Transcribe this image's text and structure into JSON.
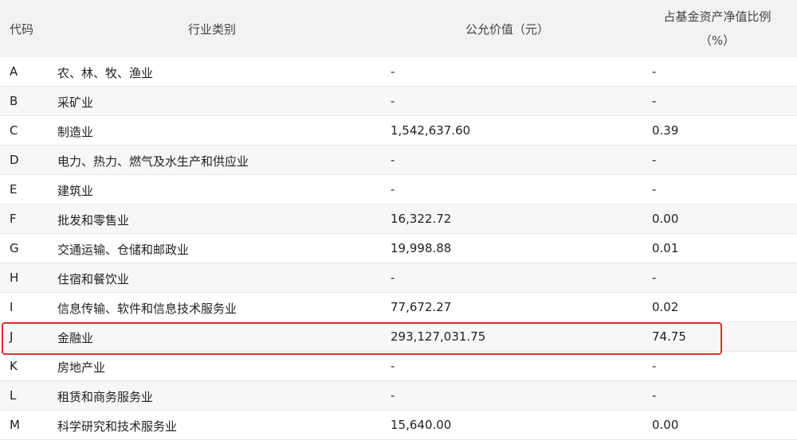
{
  "table": {
    "headers": {
      "code": "代码",
      "industry": "行业类别",
      "fair_value": "公允价值（元）",
      "ratio_line1": "占基金资产净值比例",
      "ratio_line2": "（%）"
    },
    "rows": [
      {
        "code": "A",
        "industry": "农、林、牧、渔业",
        "fair_value": "-",
        "ratio": "-"
      },
      {
        "code": "B",
        "industry": "采矿业",
        "fair_value": "-",
        "ratio": "-"
      },
      {
        "code": "C",
        "industry": "制造业",
        "fair_value": "1,542,637.60",
        "ratio": "0.39"
      },
      {
        "code": "D",
        "industry": "电力、热力、燃气及水生产和供应业",
        "fair_value": "-",
        "ratio": "-"
      },
      {
        "code": "E",
        "industry": "建筑业",
        "fair_value": "-",
        "ratio": "-"
      },
      {
        "code": "F",
        "industry": "批发和零售业",
        "fair_value": "16,322.72",
        "ratio": "0.00"
      },
      {
        "code": "G",
        "industry": "交通运输、仓储和邮政业",
        "fair_value": "19,998.88",
        "ratio": "0.01"
      },
      {
        "code": "H",
        "industry": "住宿和餐饮业",
        "fair_value": "-",
        "ratio": "-"
      },
      {
        "code": "I",
        "industry": "信息传输、软件和信息技术服务业",
        "fair_value": "77,672.27",
        "ratio": "0.02"
      },
      {
        "code": "J",
        "industry": "金融业",
        "fair_value": "293,127,031.75",
        "ratio": "74.75"
      },
      {
        "code": "K",
        "industry": "房地产业",
        "fair_value": "-",
        "ratio": "-"
      },
      {
        "code": "L",
        "industry": "租赁和商务服务业",
        "fair_value": "-",
        "ratio": "-"
      },
      {
        "code": "M",
        "industry": "科学研究和技术服务业",
        "fair_value": "15,640.00",
        "ratio": "0.00"
      }
    ]
  },
  "highlight": {
    "row_code": "J",
    "color": "#e03030"
  },
  "colors": {
    "header_bg": "#f2f2f2",
    "alt_row_bg": "#f7f7f7"
  }
}
